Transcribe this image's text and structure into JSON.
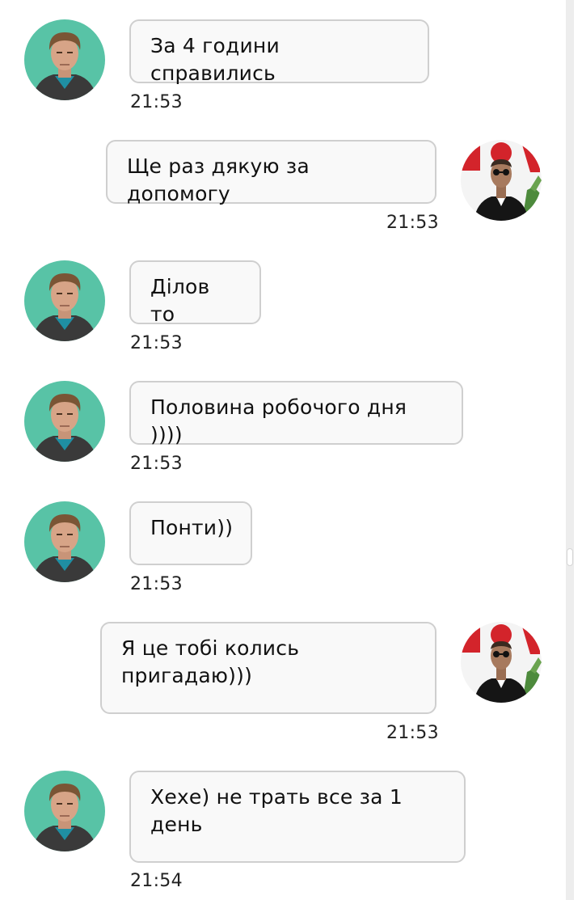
{
  "colors": {
    "bubble_bg": "#f9f9f9",
    "bubble_border": "#cfcfcf",
    "text": "#111111",
    "avatar_teal": "#58c3a6"
  },
  "messages": [
    {
      "sender": "contact",
      "avatar_icon": "man-portrait-icon",
      "text": "За 4 години справились",
      "time": "21:53"
    },
    {
      "sender": "me",
      "avatar_icon": "man-sunglasses-portrait-icon",
      "text": "Ще раз дякую за допомогу",
      "time": "21:53"
    },
    {
      "sender": "contact",
      "avatar_icon": "man-portrait-icon",
      "text": "Ділов то",
      "time": "21:53"
    },
    {
      "sender": "contact",
      "avatar_icon": "man-portrait-icon",
      "text": "Половина робочого дня ))))",
      "time": "21:53"
    },
    {
      "sender": "contact",
      "avatar_icon": "man-portrait-icon",
      "text": "Понти))",
      "time": "21:53"
    },
    {
      "sender": "me",
      "avatar_icon": "man-sunglasses-portrait-icon",
      "text": "Я це тобі колись пригадаю)))",
      "time": "21:53"
    },
    {
      "sender": "contact",
      "avatar_icon": "man-portrait-icon",
      "text": "Хехе) не трать все за 1 день",
      "time": "21:54"
    }
  ]
}
